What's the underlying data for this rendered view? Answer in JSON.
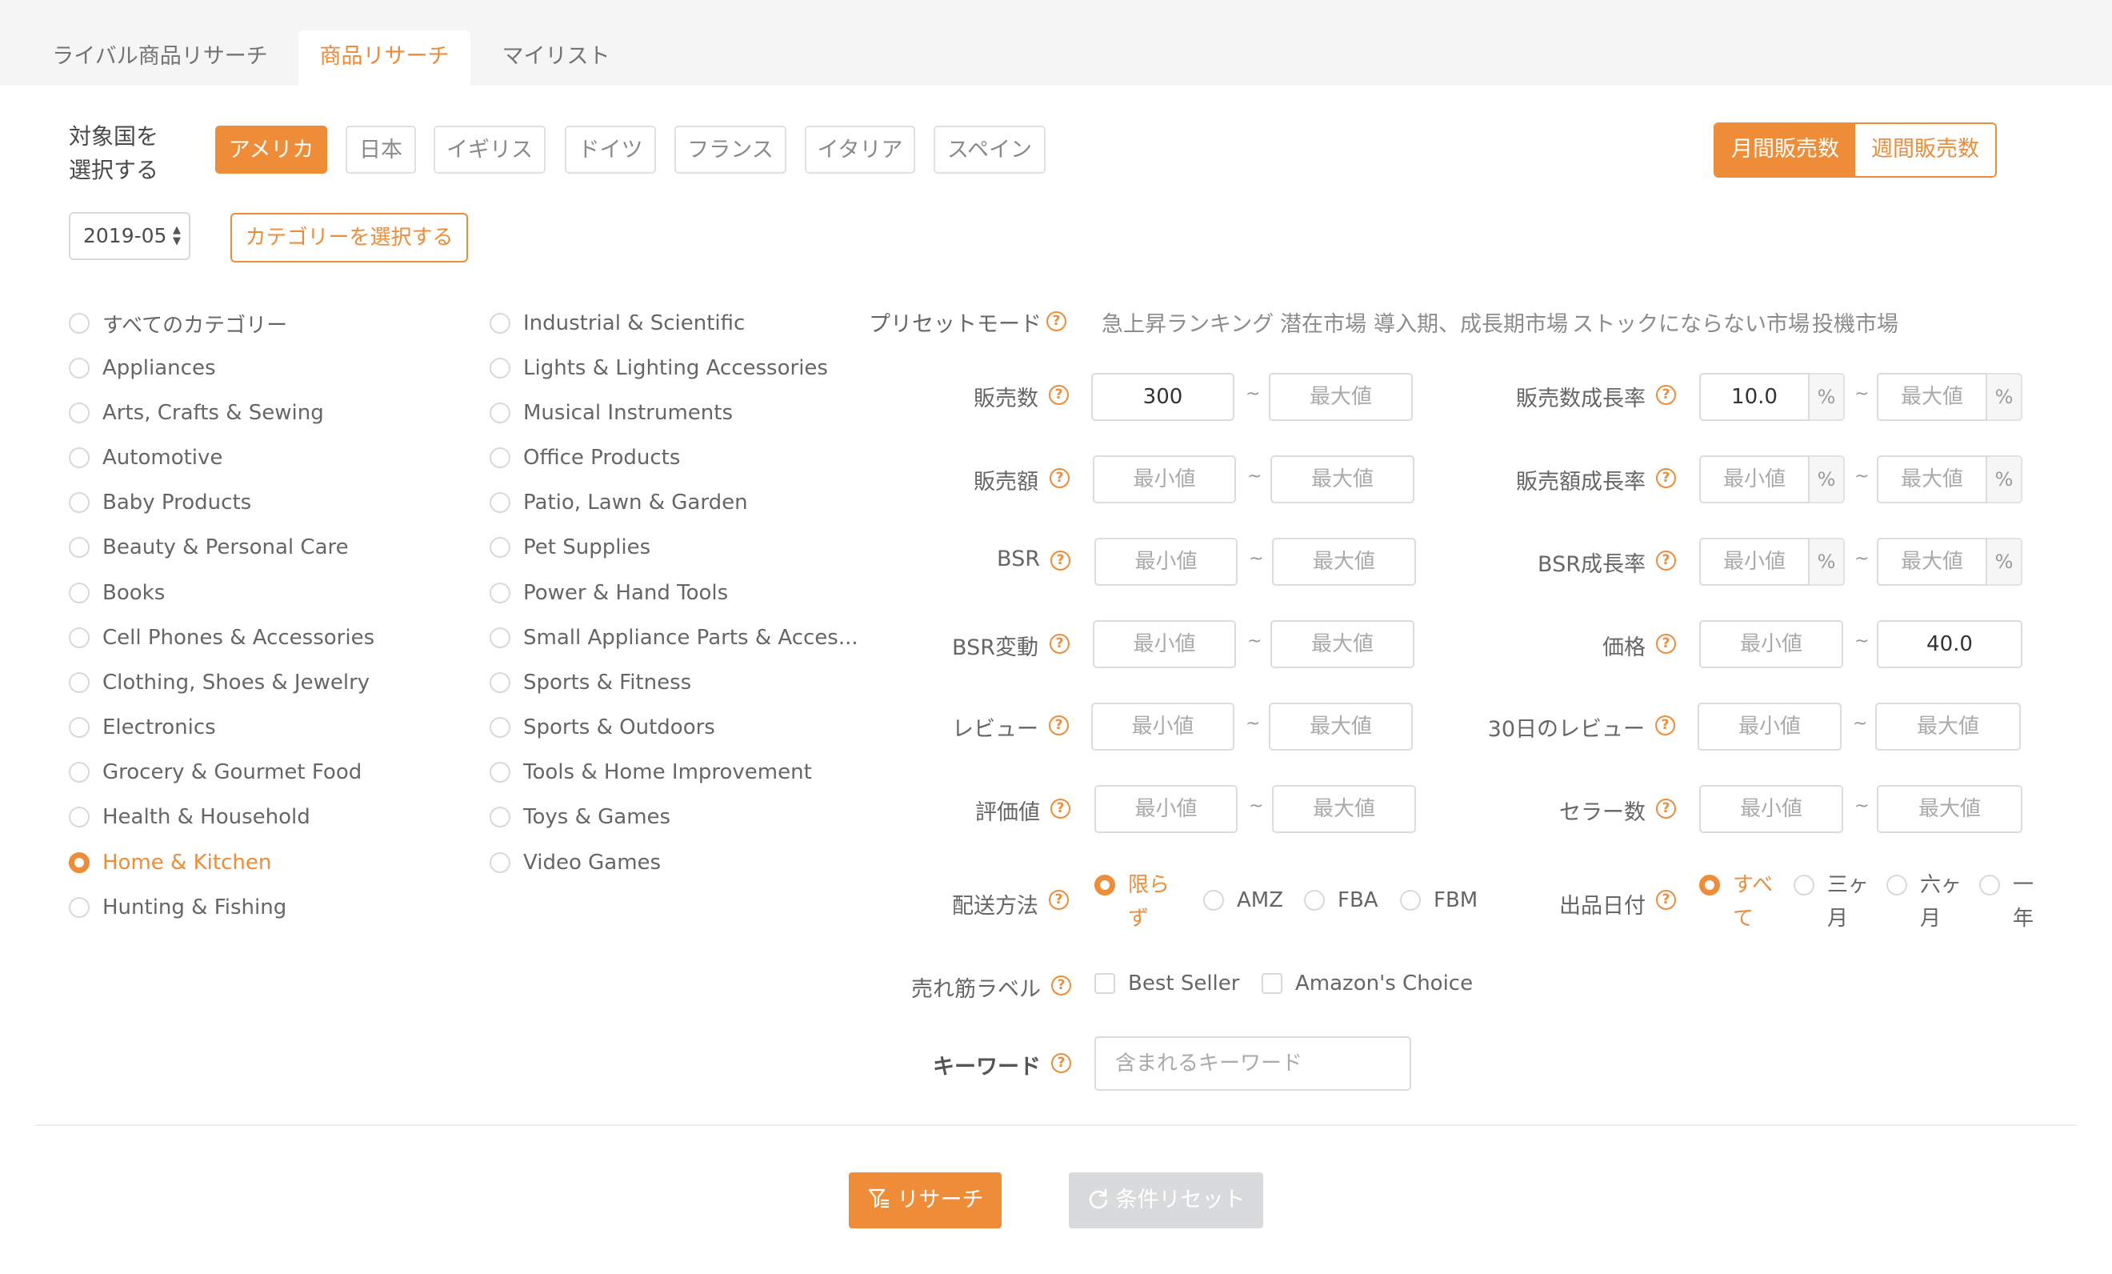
{
  "tabs": [
    {
      "label": "ライバル商品リサーチ"
    },
    {
      "label": "商品リサーチ"
    },
    {
      "label": "マイリスト"
    }
  ],
  "country": {
    "label": "対象国を\n選択する",
    "options": [
      "アメリカ",
      "日本",
      "イギリス",
      "ドイツ",
      "フランス",
      "イタリア",
      "スペイン"
    ],
    "selected": "アメリカ"
  },
  "period": {
    "options": [
      "月間販売数",
      "週間販売数"
    ],
    "selected": "月間販売数"
  },
  "date_select": {
    "value": "2019-05"
  },
  "category_button": {
    "label": "カテゴリーを選択する"
  },
  "categories": {
    "column1": [
      "すべてのカテゴリー",
      "Appliances",
      "Arts, Crafts & Sewing",
      "Automotive",
      "Baby Products",
      "Beauty & Personal Care",
      "Books",
      "Cell Phones & Accessories",
      "Clothing, Shoes & Jewelry",
      "Electronics",
      "Grocery & Gourmet Food",
      "Health & Household",
      "Home & Kitchen",
      "Hunting & Fishing"
    ],
    "column2": [
      "Industrial & Scientific",
      "Lights & Lighting Accessories",
      "Musical Instruments",
      "Office Products",
      "Patio, Lawn & Garden",
      "Pet Supplies",
      "Power & Hand Tools",
      "Small Appliance Parts & Acces...",
      "Sports & Fitness",
      "Sports & Outdoors",
      "Tools & Home Improvement",
      "Toys & Games",
      "Video Games"
    ],
    "selected": "Home & Kitchen"
  },
  "preset": {
    "label": "プリセットモード",
    "modes": [
      "急上昇ランキング",
      "潜在市場",
      "導入期、成長期市場",
      "ストックにならない市場",
      "投機市場"
    ]
  },
  "help_glyph": "?",
  "range_separator": "~",
  "percent_unit": "%",
  "filters": {
    "sales_count": {
      "label": "販売数",
      "min": "300",
      "max": "",
      "min_placeholder": "最小値",
      "max_placeholder": "最大値"
    },
    "sales_amount": {
      "label": "販売額",
      "min": "",
      "max": "",
      "min_placeholder": "最小値",
      "max_placeholder": "最大値"
    },
    "bsr": {
      "label": "BSR",
      "min": "",
      "max": "",
      "min_placeholder": "最小値",
      "max_placeholder": "最大値"
    },
    "bsr_change": {
      "label": "BSR変動",
      "min": "",
      "max": "",
      "min_placeholder": "最小値",
      "max_placeholder": "最大値"
    },
    "reviews": {
      "label": "レビュー",
      "min": "",
      "max": "",
      "min_placeholder": "最小値",
      "max_placeholder": "最大値"
    },
    "rating": {
      "label": "評価値",
      "min": "",
      "max": "",
      "min_placeholder": "最小値",
      "max_placeholder": "最大値"
    },
    "sales_growth": {
      "label": "販売数成長率",
      "min": "10.0",
      "max": "",
      "min_placeholder": "最小値",
      "max_placeholder": "最大値"
    },
    "amount_growth": {
      "label": "販売額成長率",
      "min": "",
      "max": "",
      "min_placeholder": "最小値",
      "max_placeholder": "最大値"
    },
    "bsr_growth": {
      "label": "BSR成長率",
      "min": "",
      "max": "",
      "min_placeholder": "最小値",
      "max_placeholder": "最大値"
    },
    "price": {
      "label": "価格",
      "min": "",
      "max": "40.0",
      "min_placeholder": "最小値",
      "max_placeholder": "最大値"
    },
    "reviews_30d": {
      "label": "30日のレビュー",
      "min": "",
      "max": "",
      "min_placeholder": "最小値",
      "max_placeholder": "最大値"
    },
    "seller_count": {
      "label": "セラー数",
      "min": "",
      "max": "",
      "min_placeholder": "最小値",
      "max_placeholder": "最大値"
    }
  },
  "shipping": {
    "label": "配送方法",
    "options": [
      "限ら\nず",
      "AMZ",
      "FBA",
      "FBM"
    ],
    "selected_index": 0
  },
  "listing_date": {
    "label": "出品日付",
    "options": [
      "すべ\nて",
      "三ヶ\n月",
      "六ヶ\n月",
      "一\n年"
    ],
    "selected_index": 0
  },
  "best_label": {
    "label": "売れ筋ラベル",
    "options": [
      "Best Seller",
      "Amazon's Choice"
    ]
  },
  "keyword": {
    "label": "キーワード",
    "placeholder": "含まれるキーワード",
    "value": ""
  },
  "actions": {
    "research": "リサーチ",
    "reset": "条件リセット"
  },
  "colors": {
    "accent": "#ef8c38",
    "tabbar_bg": "#f5f5f6",
    "reset_bg": "#d9dadb"
  }
}
